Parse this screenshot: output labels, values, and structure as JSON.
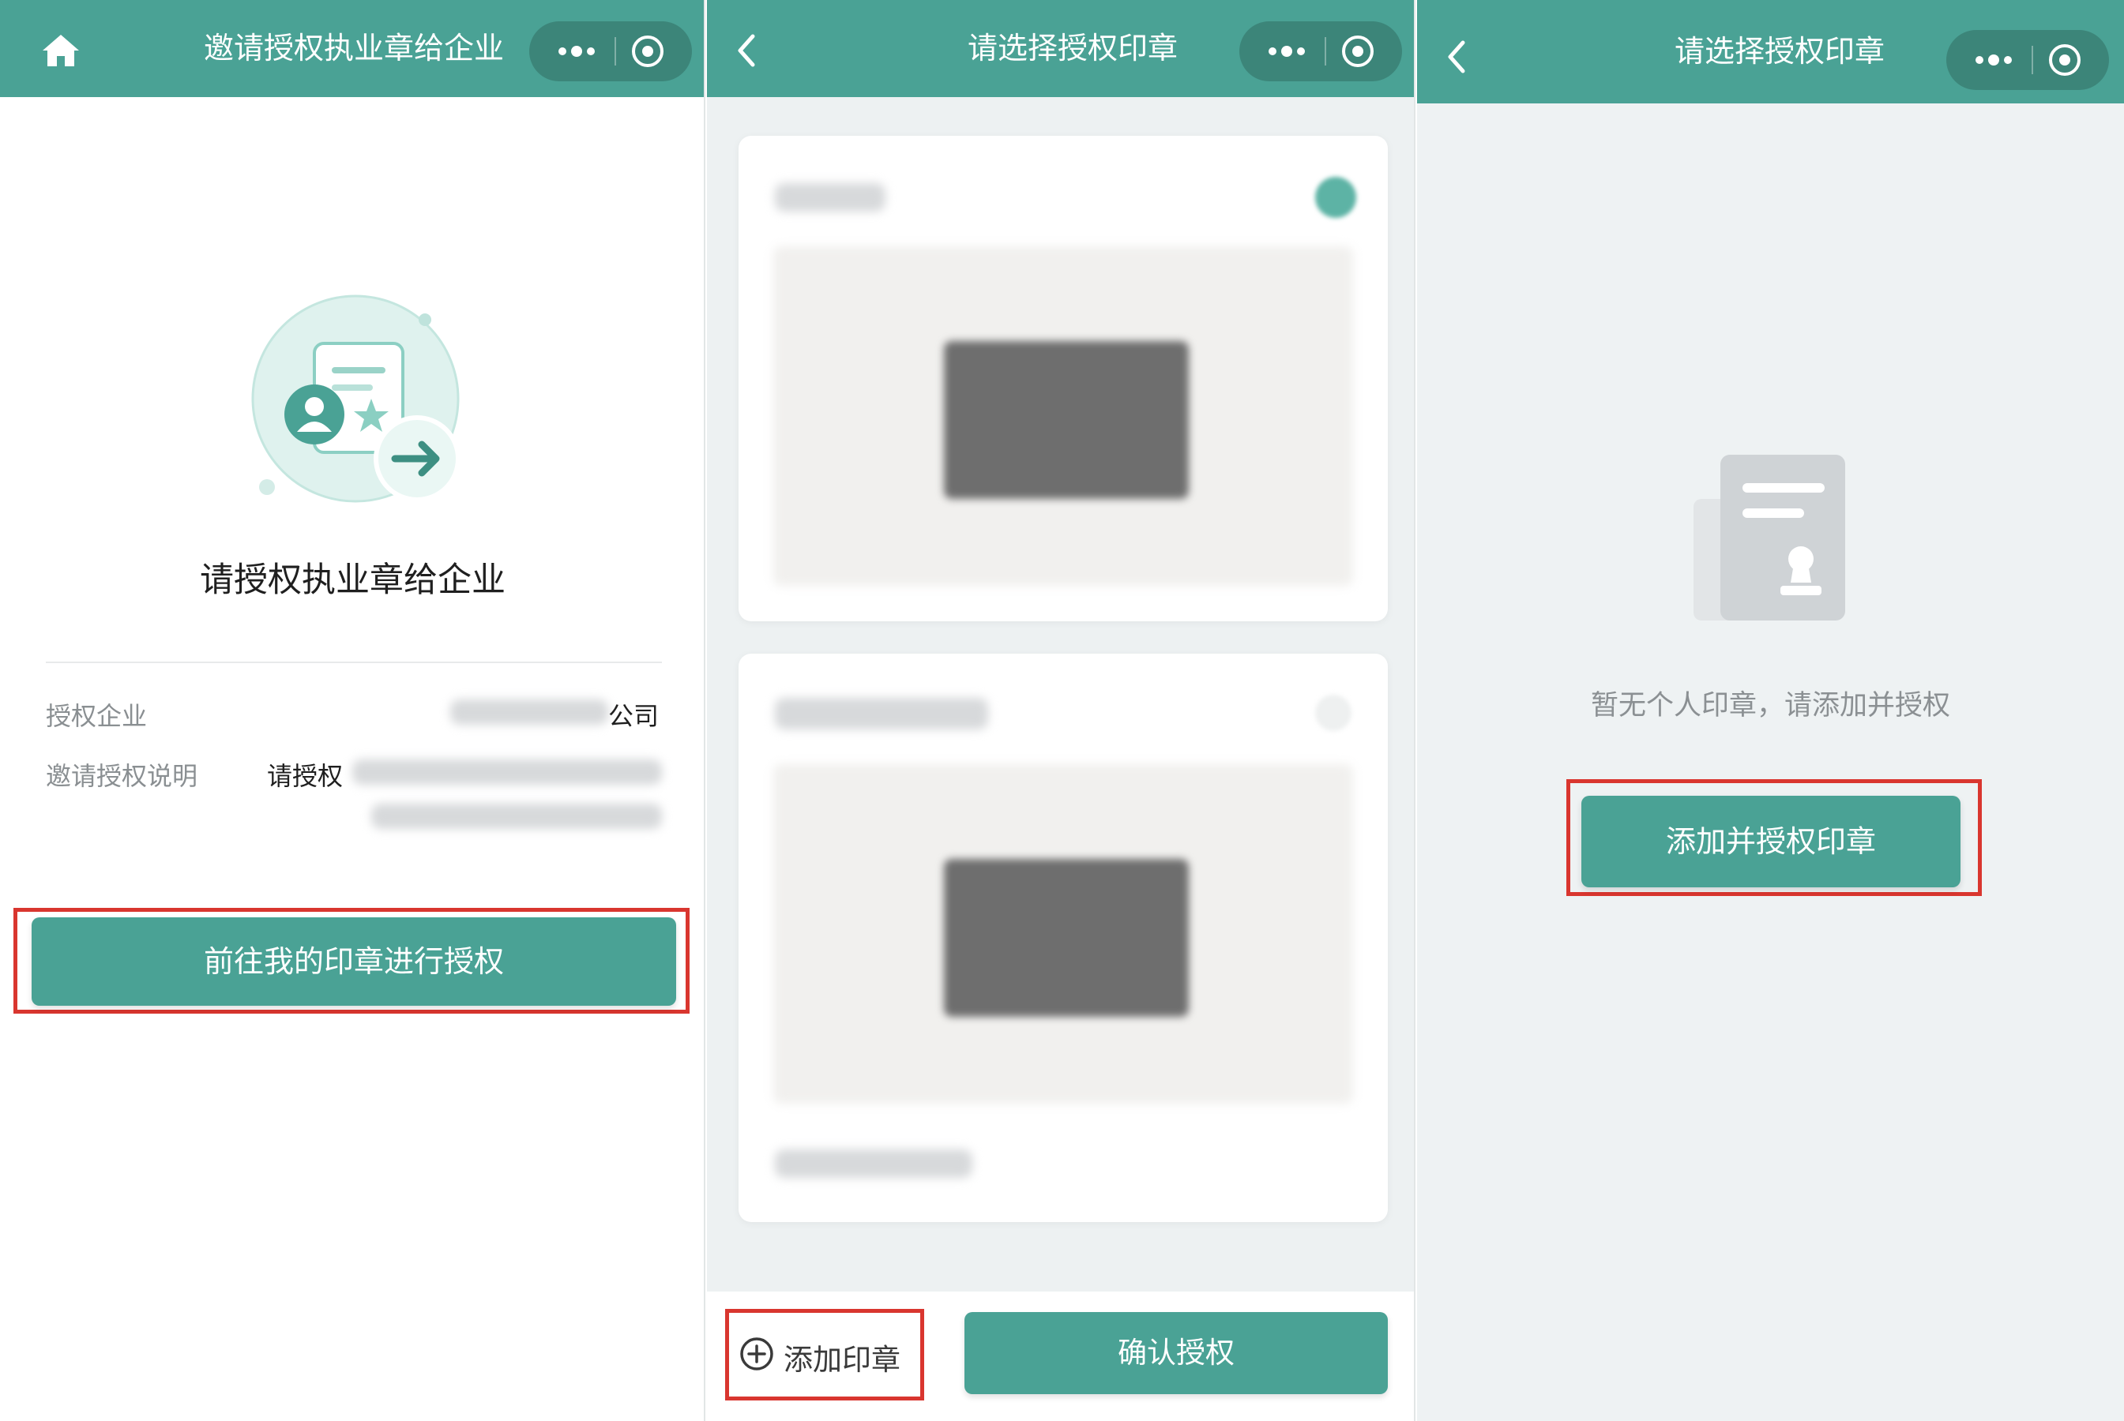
{
  "panel1": {
    "nav_title": "邀请授权执业章给企业",
    "heading": "请授权执业章给企业",
    "info": {
      "company_label": "授权企业",
      "company_value_suffix": "公司",
      "description_label": "邀请授权说明",
      "description_value_prefix": "请授权"
    },
    "primary_button": "前往我的印章进行授权"
  },
  "panel2": {
    "nav_title": "请选择授权印章",
    "add_seal_label": "添加印章",
    "confirm_button": "确认授权"
  },
  "panel3": {
    "nav_title": "请选择授权印章",
    "empty_message": "暂无个人印章，请添加并授权",
    "add_authorize_button": "添加并授权印章"
  },
  "colors": {
    "primary": "#4aa295",
    "capsule": "#3c8579",
    "highlight": "#d9362f",
    "page_bg": "#edf1f2"
  },
  "icons": {
    "home": "home-icon",
    "back": "back-chevron-icon",
    "more": "more-dots-icon",
    "close": "target-circle-icon",
    "add": "plus-circle-icon"
  }
}
